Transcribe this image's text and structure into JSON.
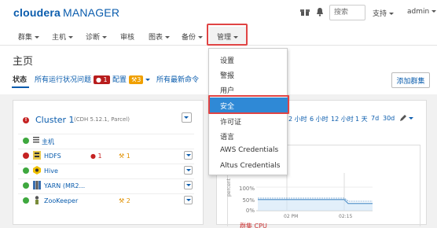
{
  "header": {
    "brand": "cloudera",
    "product": "MANAGER",
    "search_placeholder": "搜索",
    "support_label": "支持",
    "user_label": "admin"
  },
  "nav": {
    "items": [
      {
        "label": "群集"
      },
      {
        "label": "主机"
      },
      {
        "label": "诊断"
      },
      {
        "label": "审核"
      },
      {
        "label": "图表"
      },
      {
        "label": "备份"
      },
      {
        "label": "管理"
      }
    ]
  },
  "page": {
    "title": "主页"
  },
  "tabs": [
    {
      "label": "状态"
    },
    {
      "label": "所有运行状况问题",
      "badge": "1"
    },
    {
      "label": "配置",
      "badge": "3"
    },
    {
      "label": "所有最新命令"
    }
  ],
  "add_cluster_label": "添加群集",
  "admin_menu": {
    "items": [
      {
        "label": "设置"
      },
      {
        "label": "警报"
      },
      {
        "label": "用户"
      },
      {
        "label": "安全"
      },
      {
        "label": "许可证"
      },
      {
        "label": "语言"
      },
      {
        "label": "AWS Credentials"
      },
      {
        "label": "Altus Credentials"
      }
    ]
  },
  "cluster": {
    "name": "Cluster 1",
    "details": "(CDH 5.12.1, Parcel)",
    "hosts_label": "主机",
    "services": [
      {
        "name": "HDFS",
        "status": "bad",
        "alerts": "1",
        "warnings": "1"
      },
      {
        "name": "Hive",
        "status": "good",
        "alerts": "",
        "warnings": ""
      },
      {
        "name": "YARN (MR2...",
        "status": "good",
        "alerts": "",
        "warnings": ""
      },
      {
        "name": "ZooKeeper",
        "status": "good",
        "alerts": "",
        "warnings": "2"
      }
    ]
  },
  "time_range": {
    "options": [
      "2 小时",
      "6 小时",
      "12 小时",
      "1 天",
      "7d",
      "30d"
    ]
  },
  "chart": {
    "ylabel": "percent",
    "ticks_y": [
      "100%",
      "50%",
      "0%"
    ],
    "ticks_x": [
      "02 PM",
      "02:15"
    ],
    "footer": "群集 CPU"
  }
}
